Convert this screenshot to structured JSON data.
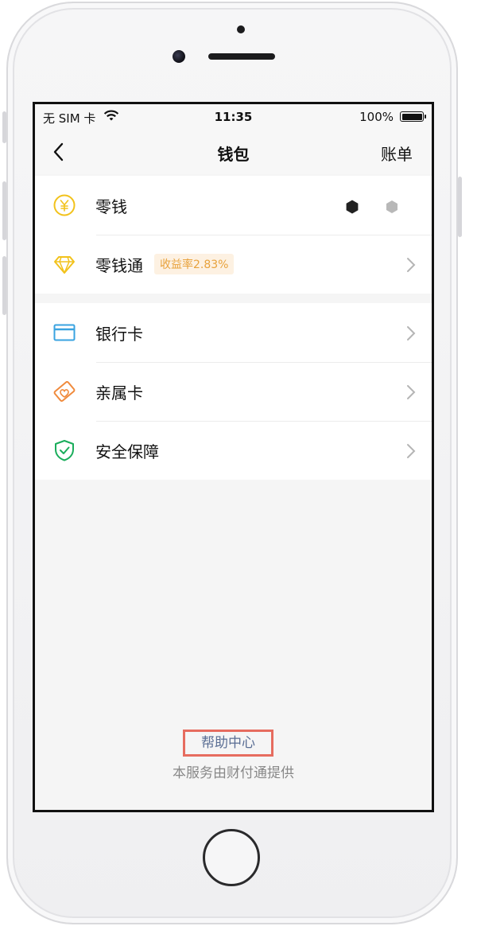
{
  "status_bar": {
    "carrier": "无 SIM 卡",
    "time": "11:35",
    "battery": "100%"
  },
  "nav": {
    "title": "钱包",
    "right_action": "账单"
  },
  "wallet_items": [
    {
      "label": "零钱",
      "icon": "yen-coin-icon",
      "color": "#f2c21b"
    },
    {
      "label": "零钱通",
      "icon": "diamond-icon",
      "color": "#f2c21b",
      "badge": "收益率2.83%"
    }
  ],
  "card_items": [
    {
      "label": "银行卡",
      "icon": "bank-card-icon",
      "color": "#3aa3e0"
    },
    {
      "label": "亲属卡",
      "icon": "family-card-icon",
      "color": "#f08a3c"
    },
    {
      "label": "安全保障",
      "icon": "shield-check-icon",
      "color": "#1aad5b"
    }
  ],
  "footer": {
    "help_link": "帮助中心",
    "provider_note": "本服务由财付通提供"
  },
  "colors": {
    "accent_orange": "#e8a23c",
    "highlight_border": "#e66c5f",
    "link_blue": "#5a6e94"
  }
}
